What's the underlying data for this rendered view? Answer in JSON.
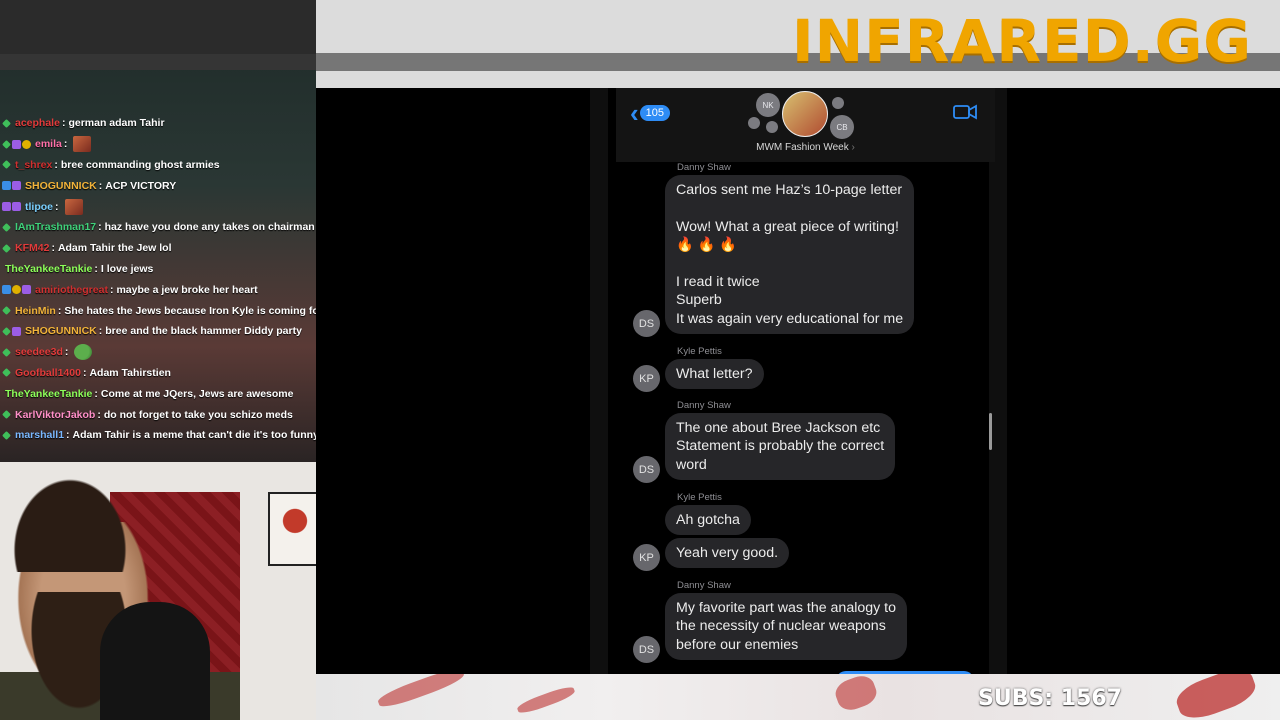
{
  "banner": {
    "brand": "INFRARED.GG",
    "brand_color": "#f0a500"
  },
  "chat": {
    "messages": [
      {
        "badges": [
          "green"
        ],
        "user": "acephale",
        "color": "#e23b3b",
        "text": "german adam Tahir",
        "emote": null
      },
      {
        "badges": [
          "green",
          "purple",
          "gold"
        ],
        "user": "emila",
        "color": "#ff6fa8",
        "text": "",
        "emote": "face-emote"
      },
      {
        "badges": [
          "green"
        ],
        "user": "t_shrex",
        "color": "#d03030",
        "text": "bree commanding ghost armies",
        "emote": null
      },
      {
        "badges": [
          "blue",
          "purple"
        ],
        "user": "SHOGUNNICK",
        "color": "#f2b43a",
        "text": "ACP VICTORY",
        "emote": null
      },
      {
        "badges": [
          "purple",
          "purple"
        ],
        "user": "tlipoe",
        "color": "#7ad0ff",
        "text": "",
        "emote": "face-emote"
      },
      {
        "badges": [
          "green"
        ],
        "user": "IAmTrashman17",
        "color": "#3fd17a",
        "text": "haz have you done any takes on chairman",
        "emote": null
      },
      {
        "badges": [
          "green"
        ],
        "user": "KFM42",
        "color": "#e23b3b",
        "text": "Adam Tahir the Jew lol",
        "emote": null
      },
      {
        "badges": [],
        "user": "TheYankeeTankie",
        "color": "#8dff5a",
        "text": "I love jews",
        "emote": null
      },
      {
        "badges": [
          "blue",
          "gold",
          "purple"
        ],
        "user": "amiriothegreat",
        "color": "#d03030",
        "text": "maybe a jew broke her heart",
        "emote": null
      },
      {
        "badges": [
          "green"
        ],
        "user": "HeinMin",
        "color": "#f2b43a",
        "text": "She hates the Jews because Iron Kyle is coming fo",
        "emote": null
      },
      {
        "badges": [
          "green",
          "purple"
        ],
        "user": "SHOGUNNICK",
        "color": "#f2b43a",
        "text": "bree and the black hammer Diddy party",
        "emote": null
      },
      {
        "badges": [
          "green"
        ],
        "user": "seedee3d",
        "color": "#e23b3b",
        "text": "",
        "emote": "pepe-emote"
      },
      {
        "badges": [
          "green"
        ],
        "user": "Goofball1400",
        "color": "#e23b3b",
        "text": "Adam Tahirstien",
        "emote": null
      },
      {
        "badges": [],
        "user": "TheYankeeTankie",
        "color": "#8dff5a",
        "text": "Come at me JQers, Jews are awesome",
        "emote": null
      },
      {
        "badges": [
          "green"
        ],
        "user": "KarlViktorJakob",
        "color": "#ff8fc8",
        "text": "do not forget to take you schizo meds",
        "emote": null
      },
      {
        "badges": [
          "green"
        ],
        "user": "marshall1",
        "color": "#7ab8ff",
        "text": "Adam Tahir is a meme that can't die it's too funny",
        "emote": null
      }
    ]
  },
  "imessage": {
    "back_count": "105",
    "group_name": "MWM Fashion Week",
    "group_name_chevron": "›",
    "avatars": {
      "a1": "NK",
      "a2": "CB"
    },
    "messages": [
      {
        "sender": "Danny Shaw",
        "avatar": "DS",
        "bubbles": [
          "Carlos sent me Haz’s 10-page letter\n\nWow! What a great piece of writing!\n🔥 🔥 🔥\n\nI read it twice\nSuperb\nIt was again very educational for me"
        ]
      },
      {
        "sender": "Kyle Pettis",
        "avatar": "KP",
        "bubbles": [
          "What letter?"
        ]
      },
      {
        "sender": "Danny Shaw",
        "avatar": "DS",
        "bubbles": [
          "The one about Bree Jackson etc\nStatement is probably the correct\nword"
        ]
      },
      {
        "sender": "Kyle Pettis",
        "avatar": "KP",
        "bubbles": [
          "Ah gotcha",
          "Yeah very good."
        ]
      },
      {
        "sender": "Danny Shaw",
        "avatar": "DS",
        "bubbles": [
          "My favorite part was the analogy to\nthe necessity of nuclear weapons\nbefore our enemies"
        ]
      }
    ]
  },
  "footer": {
    "subs": "SUBS: 1567"
  }
}
